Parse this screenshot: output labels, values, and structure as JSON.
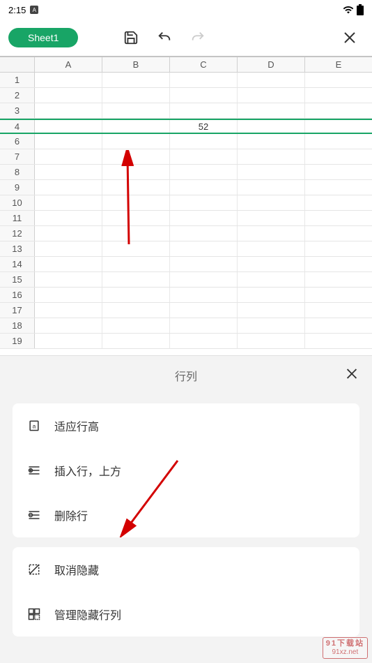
{
  "status": {
    "time": "2:15",
    "indicator": "A"
  },
  "toolbar": {
    "sheet_name": "Sheet1"
  },
  "sheet": {
    "columns": [
      "A",
      "B",
      "C",
      "D",
      "E"
    ],
    "rows": [
      1,
      2,
      3,
      4,
      6,
      7,
      8,
      9,
      10,
      11,
      12,
      13,
      14,
      15,
      16,
      17,
      18,
      19
    ],
    "cell_value": "52"
  },
  "panel": {
    "title": "行列",
    "items_group1": [
      {
        "label": "适应行高",
        "icon": "fit-height"
      },
      {
        "label": "插入行，上方",
        "icon": "insert-row"
      },
      {
        "label": "删除行",
        "icon": "delete-row"
      }
    ],
    "items_group2": [
      {
        "label": "取消隐藏",
        "icon": "unhide"
      },
      {
        "label": "管理隐藏行列",
        "icon": "manage-hidden"
      }
    ]
  },
  "watermark": {
    "line1": "91下载站",
    "line2": "91xz.net"
  }
}
